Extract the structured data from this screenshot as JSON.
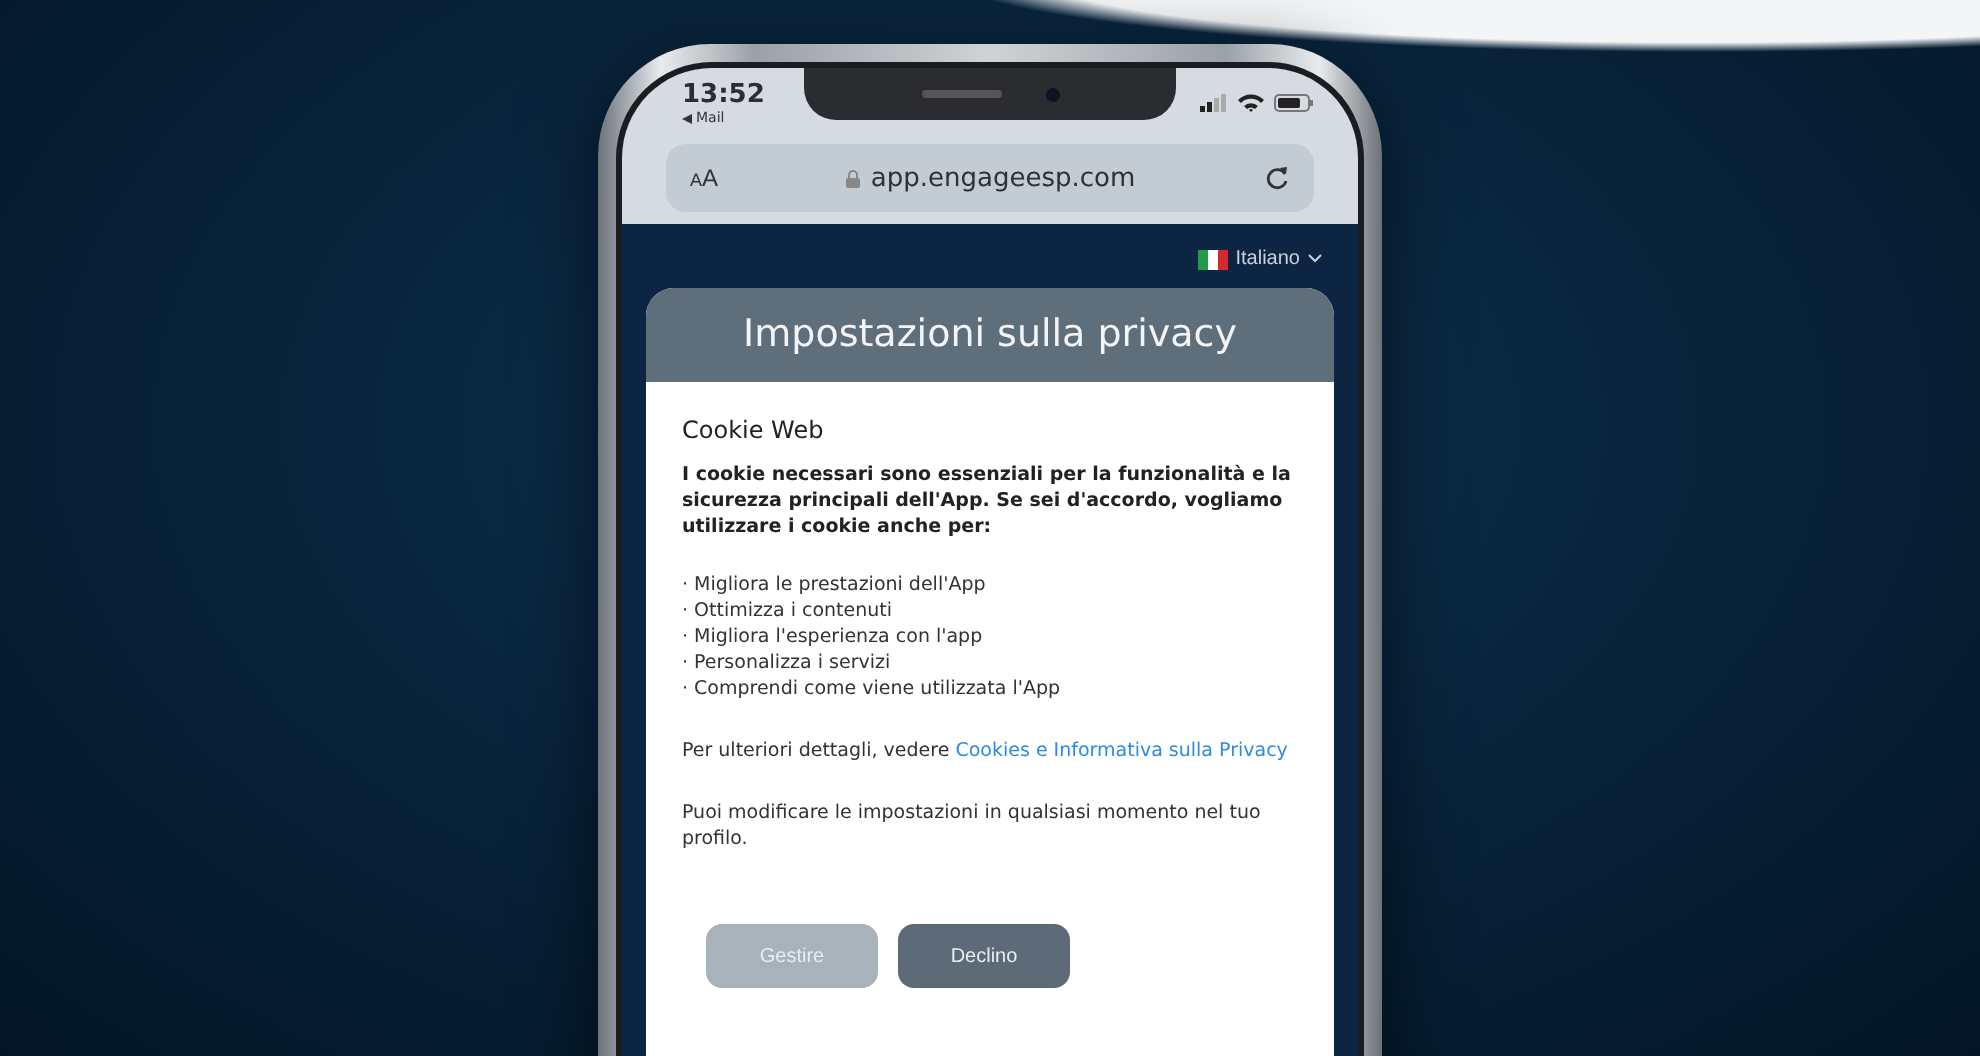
{
  "status_bar": {
    "time": "13:52",
    "back_label": "Mail"
  },
  "browser": {
    "text_size_button": "AA",
    "url": "app.engageesp.com"
  },
  "language": {
    "label": "Italiano"
  },
  "dialog": {
    "title": "Impostazioni sulla privacy",
    "section_title": "Cookie Web",
    "intro": "I cookie necessari sono essenziali per la funzionalità e la sicurezza principali dell'App. Se sei d'accordo, vogliamo utilizzare i cookie anche per:",
    "bullets": [
      "· Migliora le prestazioni dell'App",
      "· Ottimizza i contenuti",
      "· Migliora l'esperienza con l'app",
      "· Personalizza i servizi",
      "· Comprendi come viene utilizzata l'App"
    ],
    "details": {
      "text": "Per ulteriori dettagli, vedere",
      "link": "Cookies e Informativa sulla Privacy"
    },
    "note": "Puoi modificare le impostazioni in qualsiasi momento nel tuo profilo.",
    "buttons": [
      {
        "label": "Gestire",
        "disabled": true
      },
      {
        "label": "Declino",
        "disabled": false
      }
    ]
  }
}
